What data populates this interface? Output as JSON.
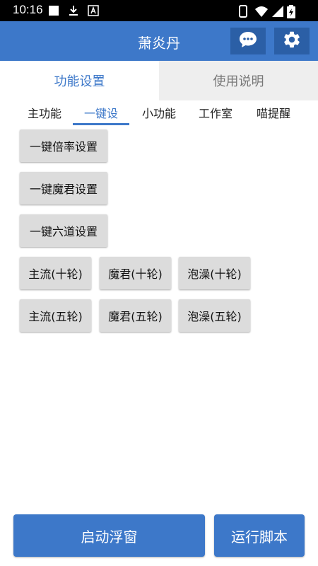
{
  "status_bar": {
    "time": "10:16"
  },
  "app_bar": {
    "title": "萧炎丹"
  },
  "main_tabs": [
    "功能设置",
    "使用说明"
  ],
  "sub_tabs": [
    "主功能",
    "一键设",
    "小功能",
    "工作室",
    "喵提醒"
  ],
  "setting_buttons": [
    "一键倍率设置",
    "一键魔君设置",
    "一键六道设置"
  ],
  "route_buttons": {
    "ten_rounds": [
      "主流(十轮)",
      "魔君(十轮)",
      "泡澡(十轮)"
    ],
    "five_rounds": [
      "主流(五轮)",
      "魔君(五轮)",
      "泡澡(五轮)"
    ]
  },
  "bottom_buttons": {
    "float_window": "启动浮窗",
    "run_script": "运行脚本"
  },
  "colors": {
    "primary": "#3d78c9",
    "primary_dark": "#2b5fa6",
    "button_gray": "#dcdcdc",
    "inactive_tab": "#eeeeee"
  }
}
